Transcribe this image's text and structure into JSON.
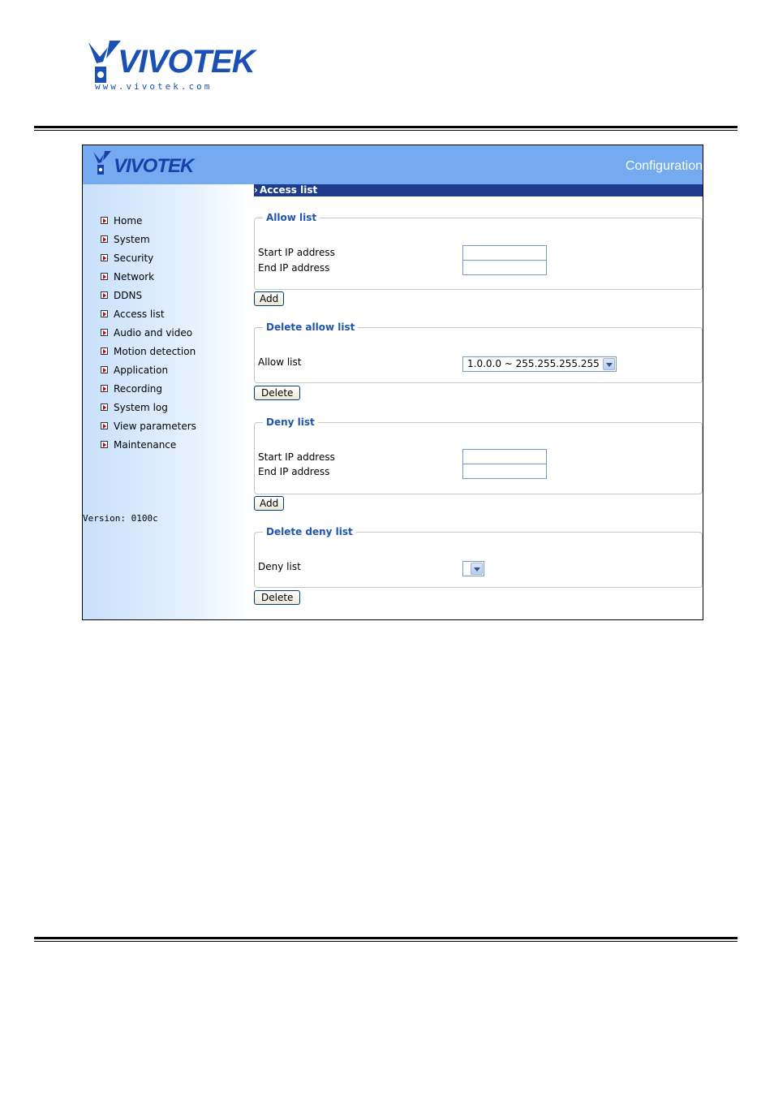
{
  "document": {
    "logo_text": "VIVOTEK",
    "logo_url": "www.vivotek.com"
  },
  "banner": {
    "logo_text": "VIVOTEK",
    "title": "Configuration"
  },
  "sidebar": {
    "items": [
      {
        "label": "Home"
      },
      {
        "label": "System"
      },
      {
        "label": "Security"
      },
      {
        "label": "Network"
      },
      {
        "label": "DDNS"
      },
      {
        "label": "Access list"
      },
      {
        "label": "Audio and video"
      },
      {
        "label": "Motion detection"
      },
      {
        "label": "Application"
      },
      {
        "label": "Recording"
      },
      {
        "label": "System log"
      },
      {
        "label": "View parameters"
      },
      {
        "label": "Maintenance"
      }
    ],
    "version": "Version: 0100c"
  },
  "main": {
    "section_title": "Access list",
    "allow_list": {
      "legend": "Allow list",
      "start_label": "Start IP address",
      "end_label": "End IP address",
      "start_value": "",
      "end_value": "",
      "add_label": "Add"
    },
    "delete_allow": {
      "legend": "Delete allow list",
      "label": "Allow list",
      "selected": "1.0.0.0 ~ 255.255.255.255",
      "delete_label": "Delete"
    },
    "deny_list": {
      "legend": "Deny list",
      "start_label": "Start IP address",
      "end_label": "End IP address",
      "start_value": "",
      "end_value": "",
      "add_label": "Add"
    },
    "delete_deny": {
      "legend": "Delete deny list",
      "label": "Deny list",
      "selected": "",
      "delete_label": "Delete"
    }
  },
  "colors": {
    "banner": "#73aaf0",
    "section_bar": "#1e3a8a",
    "legend": "#1f55b0",
    "brand": "#1a4fb3"
  }
}
